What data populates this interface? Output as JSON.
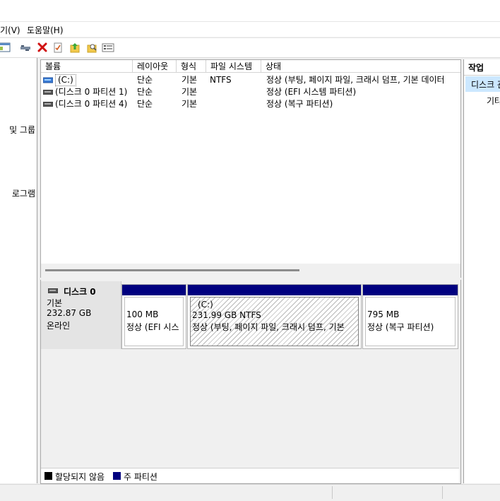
{
  "menu": {
    "view": "기(V)",
    "help": "도움말(H)"
  },
  "toolbar": {
    "icons": [
      "console-tree-icon",
      "connect-icon",
      "delete-icon",
      "properties-icon",
      "up-folder-icon",
      "find-icon",
      "list-icon"
    ]
  },
  "left_pane": {
    "items": [
      "및 그룹",
      "로그램"
    ]
  },
  "volume_list": {
    "headers": [
      "볼륨",
      "레이아웃",
      "형식",
      "파일 시스템",
      "상태"
    ],
    "rows": [
      {
        "volume": "(C:)",
        "layout": "단순",
        "type": "기본",
        "fs": "NTFS",
        "status": "정상 (부팅, 페이지 파일, 크래시 덤프, 기본 데이터"
      },
      {
        "volume": "(디스크 0 파티션 1)",
        "layout": "단순",
        "type": "기본",
        "fs": "",
        "status": "정상 (EFI 시스템 파티션)"
      },
      {
        "volume": "(디스크 0 파티션 4)",
        "layout": "단순",
        "type": "기본",
        "fs": "",
        "status": "정상 (복구 파티션)"
      }
    ]
  },
  "disk": {
    "name": "디스크 0",
    "type": "기본",
    "size": "232.87 GB",
    "state": "온라인",
    "partitions": [
      {
        "label": "",
        "size": "100 MB",
        "status": "정상 (EFI 시스"
      },
      {
        "label": "(C:)",
        "size": "231.99 GB NTFS",
        "status": "정상 (부팅, 페이지 파일, 크래시 덤프, 기본"
      },
      {
        "label": "",
        "size": "795 MB",
        "status": "정상 (복구 파티션)"
      }
    ]
  },
  "legend": {
    "unallocated": "할당되지 않음",
    "primary": "주 파티션"
  },
  "actions": {
    "title": "작업",
    "selected": "디스크 관",
    "other": "기타"
  },
  "colors": {
    "primary_partition": "#00007f",
    "unallocated": "#000000",
    "selection": "#cce8ff"
  }
}
